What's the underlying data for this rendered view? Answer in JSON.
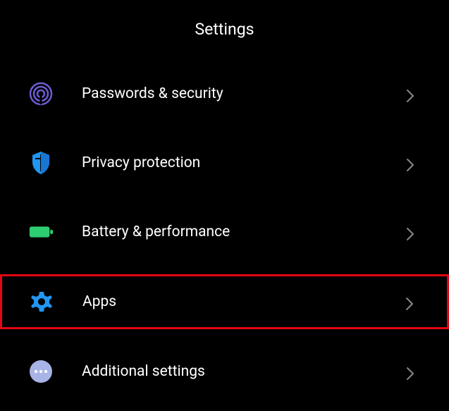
{
  "header": {
    "title": "Settings"
  },
  "items": [
    {
      "label": "Passwords & security",
      "icon": "fingerprint-icon",
      "iconColor": "#6b5dd3",
      "highlighted": false
    },
    {
      "label": "Privacy protection",
      "icon": "shield-icon",
      "iconColor": "#2196f3",
      "highlighted": false
    },
    {
      "label": "Battery & performance",
      "icon": "battery-icon",
      "iconColor": "#2ecc71",
      "highlighted": false
    },
    {
      "label": "Apps",
      "icon": "gear-icon",
      "iconColor": "#2196f3",
      "highlighted": true
    },
    {
      "label": "Additional settings",
      "icon": "dots-icon",
      "iconColor": "#a8b4e6",
      "highlighted": false
    }
  ]
}
